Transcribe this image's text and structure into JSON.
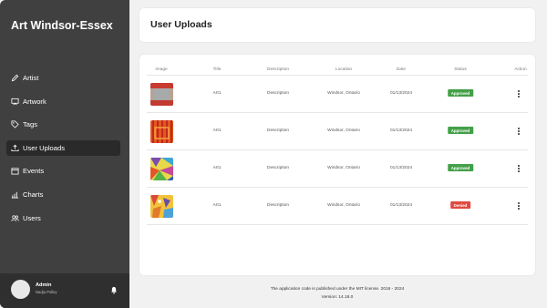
{
  "sidebar": {
    "brand": "Art Windsor-Essex",
    "items": [
      {
        "label": "Artist",
        "icon": "pencil-icon",
        "active": false
      },
      {
        "label": "Artwork",
        "icon": "easel-icon",
        "active": false
      },
      {
        "label": "Tags",
        "icon": "tag-icon",
        "active": false
      },
      {
        "label": "User Uploads",
        "icon": "upload-icon",
        "active": true
      },
      {
        "label": "Events",
        "icon": "calendar-icon",
        "active": false
      },
      {
        "label": "Charts",
        "icon": "bar-chart-icon",
        "active": false
      },
      {
        "label": "Users",
        "icon": "users-icon",
        "active": false
      }
    ],
    "user": {
      "name": "Admin",
      "subtitle": "Nadja Polley",
      "icon": "bell-icon"
    }
  },
  "header": {
    "title": "User Uploads"
  },
  "table": {
    "columns": [
      "Image",
      "Title",
      "Description",
      "Location",
      "Date",
      "Status",
      "Action"
    ],
    "rows": [
      {
        "title": "Art1",
        "description": "Description",
        "location": "Windsor, Ontario",
        "date": "01/13/2024",
        "status": "Approved",
        "status_color": "#43a047",
        "image": "red-gray-painting"
      },
      {
        "title": "Art1",
        "description": "Description",
        "location": "Windsor, Ontario",
        "date": "01/13/2024",
        "status": "Approved",
        "status_color": "#43a047",
        "image": "orange-striped-painting"
      },
      {
        "title": "Art1",
        "description": "Description",
        "location": "Windsor, Ontario",
        "date": "01/13/2024",
        "status": "Approved",
        "status_color": "#43a047",
        "image": "colorful-geometric-painting"
      },
      {
        "title": "Art1",
        "description": "Description",
        "location": "Windsor, Ontario",
        "date": "01/13/2024",
        "status": "Denied",
        "status_color": "#e04a3f",
        "image": "yellow-abstract-painting"
      }
    ]
  },
  "footer": {
    "license": "The application code is published under the MIT license. 2016 - 2024",
    "version": "Version: 14.18.0"
  }
}
